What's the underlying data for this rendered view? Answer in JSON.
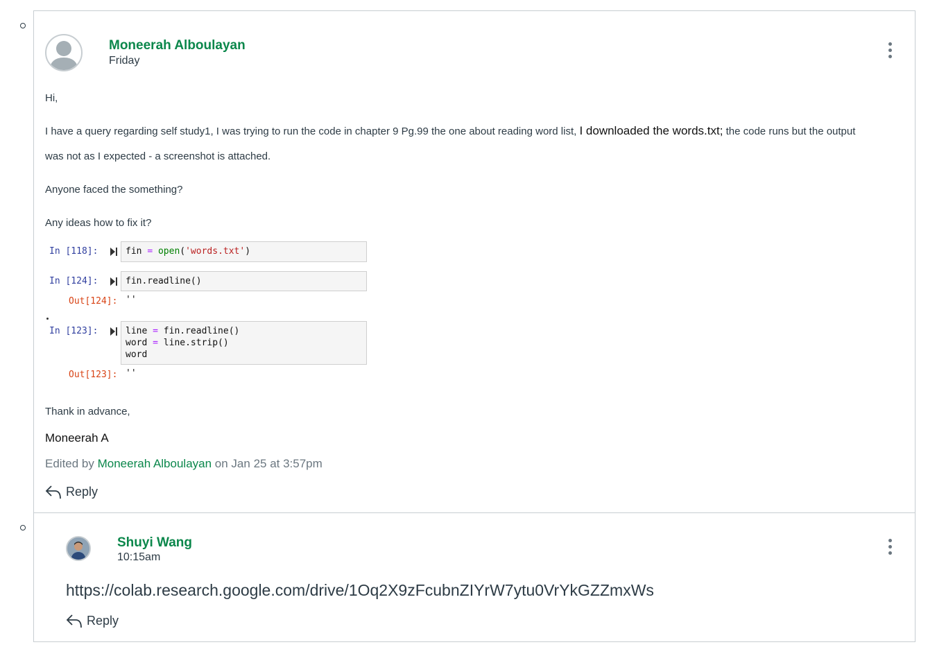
{
  "posts": [
    {
      "author": "Moneerah Alboulayan",
      "time": "Friday",
      "greeting": "Hi,",
      "body_part1": "I have a query regarding self study1, I was trying to run the code in chapter 9 Pg.99 the one about reading word list, ",
      "body_highlight": "I downloaded the words.txt;",
      "body_part2": " the code runs but the output",
      "body_line2": "was not as I expected - a screenshot is attached.",
      "question1": "Anyone faced the something?",
      "question2": "Any ideas how to fix it?",
      "notebook": {
        "cell1_label": "In [118]:",
        "cell2_label": "In [124]:",
        "out2_label": "Out[124]:",
        "out2_value": "''",
        "cell3_label": "In [123]:",
        "out3_label": "Out[123]:",
        "out3_value": "''"
      },
      "closing": "Thank in advance,",
      "signature": "Moneerah A",
      "edited_prefix": "Edited by ",
      "edited_by": "Moneerah Alboulayan",
      "edited_suffix": " on Jan 25 at 3:57pm",
      "reply_label": "Reply"
    },
    {
      "author": "Shuyi Wang",
      "time": "10:15am",
      "url": "https://colab.research.google.com/drive/1Oq2X9zFcubnZIYrW7ytu0VrYkGZZmxWs",
      "reply_label": "Reply"
    }
  ],
  "colors": {
    "author": "#0b874b",
    "text": "#2d3b45",
    "muted": "#6b7780",
    "border": "#c7cdd1"
  },
  "icons": {
    "more": "kebab-icon",
    "reply": "reply-arrow-icon",
    "run": "run-cell-icon"
  }
}
